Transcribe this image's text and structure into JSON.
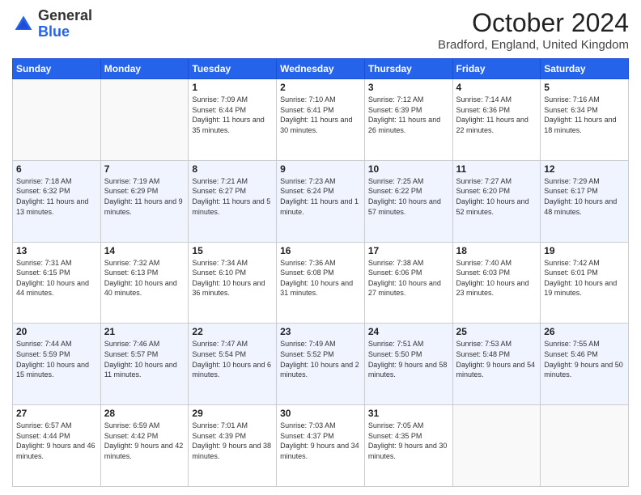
{
  "header": {
    "logo_line1": "General",
    "logo_line2": "Blue",
    "month_title": "October 2024",
    "location": "Bradford, England, United Kingdom"
  },
  "weekdays": [
    "Sunday",
    "Monday",
    "Tuesday",
    "Wednesday",
    "Thursday",
    "Friday",
    "Saturday"
  ],
  "weeks": [
    [
      {
        "day": "",
        "sunrise": "",
        "sunset": "",
        "daylight": ""
      },
      {
        "day": "",
        "sunrise": "",
        "sunset": "",
        "daylight": ""
      },
      {
        "day": "1",
        "sunrise": "Sunrise: 7:09 AM",
        "sunset": "Sunset: 6:44 PM",
        "daylight": "Daylight: 11 hours and 35 minutes."
      },
      {
        "day": "2",
        "sunrise": "Sunrise: 7:10 AM",
        "sunset": "Sunset: 6:41 PM",
        "daylight": "Daylight: 11 hours and 30 minutes."
      },
      {
        "day": "3",
        "sunrise": "Sunrise: 7:12 AM",
        "sunset": "Sunset: 6:39 PM",
        "daylight": "Daylight: 11 hours and 26 minutes."
      },
      {
        "day": "4",
        "sunrise": "Sunrise: 7:14 AM",
        "sunset": "Sunset: 6:36 PM",
        "daylight": "Daylight: 11 hours and 22 minutes."
      },
      {
        "day": "5",
        "sunrise": "Sunrise: 7:16 AM",
        "sunset": "Sunset: 6:34 PM",
        "daylight": "Daylight: 11 hours and 18 minutes."
      }
    ],
    [
      {
        "day": "6",
        "sunrise": "Sunrise: 7:18 AM",
        "sunset": "Sunset: 6:32 PM",
        "daylight": "Daylight: 11 hours and 13 minutes."
      },
      {
        "day": "7",
        "sunrise": "Sunrise: 7:19 AM",
        "sunset": "Sunset: 6:29 PM",
        "daylight": "Daylight: 11 hours and 9 minutes."
      },
      {
        "day": "8",
        "sunrise": "Sunrise: 7:21 AM",
        "sunset": "Sunset: 6:27 PM",
        "daylight": "Daylight: 11 hours and 5 minutes."
      },
      {
        "day": "9",
        "sunrise": "Sunrise: 7:23 AM",
        "sunset": "Sunset: 6:24 PM",
        "daylight": "Daylight: 11 hours and 1 minute."
      },
      {
        "day": "10",
        "sunrise": "Sunrise: 7:25 AM",
        "sunset": "Sunset: 6:22 PM",
        "daylight": "Daylight: 10 hours and 57 minutes."
      },
      {
        "day": "11",
        "sunrise": "Sunrise: 7:27 AM",
        "sunset": "Sunset: 6:20 PM",
        "daylight": "Daylight: 10 hours and 52 minutes."
      },
      {
        "day": "12",
        "sunrise": "Sunrise: 7:29 AM",
        "sunset": "Sunset: 6:17 PM",
        "daylight": "Daylight: 10 hours and 48 minutes."
      }
    ],
    [
      {
        "day": "13",
        "sunrise": "Sunrise: 7:31 AM",
        "sunset": "Sunset: 6:15 PM",
        "daylight": "Daylight: 10 hours and 44 minutes."
      },
      {
        "day": "14",
        "sunrise": "Sunrise: 7:32 AM",
        "sunset": "Sunset: 6:13 PM",
        "daylight": "Daylight: 10 hours and 40 minutes."
      },
      {
        "day": "15",
        "sunrise": "Sunrise: 7:34 AM",
        "sunset": "Sunset: 6:10 PM",
        "daylight": "Daylight: 10 hours and 36 minutes."
      },
      {
        "day": "16",
        "sunrise": "Sunrise: 7:36 AM",
        "sunset": "Sunset: 6:08 PM",
        "daylight": "Daylight: 10 hours and 31 minutes."
      },
      {
        "day": "17",
        "sunrise": "Sunrise: 7:38 AM",
        "sunset": "Sunset: 6:06 PM",
        "daylight": "Daylight: 10 hours and 27 minutes."
      },
      {
        "day": "18",
        "sunrise": "Sunrise: 7:40 AM",
        "sunset": "Sunset: 6:03 PM",
        "daylight": "Daylight: 10 hours and 23 minutes."
      },
      {
        "day": "19",
        "sunrise": "Sunrise: 7:42 AM",
        "sunset": "Sunset: 6:01 PM",
        "daylight": "Daylight: 10 hours and 19 minutes."
      }
    ],
    [
      {
        "day": "20",
        "sunrise": "Sunrise: 7:44 AM",
        "sunset": "Sunset: 5:59 PM",
        "daylight": "Daylight: 10 hours and 15 minutes."
      },
      {
        "day": "21",
        "sunrise": "Sunrise: 7:46 AM",
        "sunset": "Sunset: 5:57 PM",
        "daylight": "Daylight: 10 hours and 11 minutes."
      },
      {
        "day": "22",
        "sunrise": "Sunrise: 7:47 AM",
        "sunset": "Sunset: 5:54 PM",
        "daylight": "Daylight: 10 hours and 6 minutes."
      },
      {
        "day": "23",
        "sunrise": "Sunrise: 7:49 AM",
        "sunset": "Sunset: 5:52 PM",
        "daylight": "Daylight: 10 hours and 2 minutes."
      },
      {
        "day": "24",
        "sunrise": "Sunrise: 7:51 AM",
        "sunset": "Sunset: 5:50 PM",
        "daylight": "Daylight: 9 hours and 58 minutes."
      },
      {
        "day": "25",
        "sunrise": "Sunrise: 7:53 AM",
        "sunset": "Sunset: 5:48 PM",
        "daylight": "Daylight: 9 hours and 54 minutes."
      },
      {
        "day": "26",
        "sunrise": "Sunrise: 7:55 AM",
        "sunset": "Sunset: 5:46 PM",
        "daylight": "Daylight: 9 hours and 50 minutes."
      }
    ],
    [
      {
        "day": "27",
        "sunrise": "Sunrise: 6:57 AM",
        "sunset": "Sunset: 4:44 PM",
        "daylight": "Daylight: 9 hours and 46 minutes."
      },
      {
        "day": "28",
        "sunrise": "Sunrise: 6:59 AM",
        "sunset": "Sunset: 4:42 PM",
        "daylight": "Daylight: 9 hours and 42 minutes."
      },
      {
        "day": "29",
        "sunrise": "Sunrise: 7:01 AM",
        "sunset": "Sunset: 4:39 PM",
        "daylight": "Daylight: 9 hours and 38 minutes."
      },
      {
        "day": "30",
        "sunrise": "Sunrise: 7:03 AM",
        "sunset": "Sunset: 4:37 PM",
        "daylight": "Daylight: 9 hours and 34 minutes."
      },
      {
        "day": "31",
        "sunrise": "Sunrise: 7:05 AM",
        "sunset": "Sunset: 4:35 PM",
        "daylight": "Daylight: 9 hours and 30 minutes."
      },
      {
        "day": "",
        "sunrise": "",
        "sunset": "",
        "daylight": ""
      },
      {
        "day": "",
        "sunrise": "",
        "sunset": "",
        "daylight": ""
      }
    ]
  ]
}
